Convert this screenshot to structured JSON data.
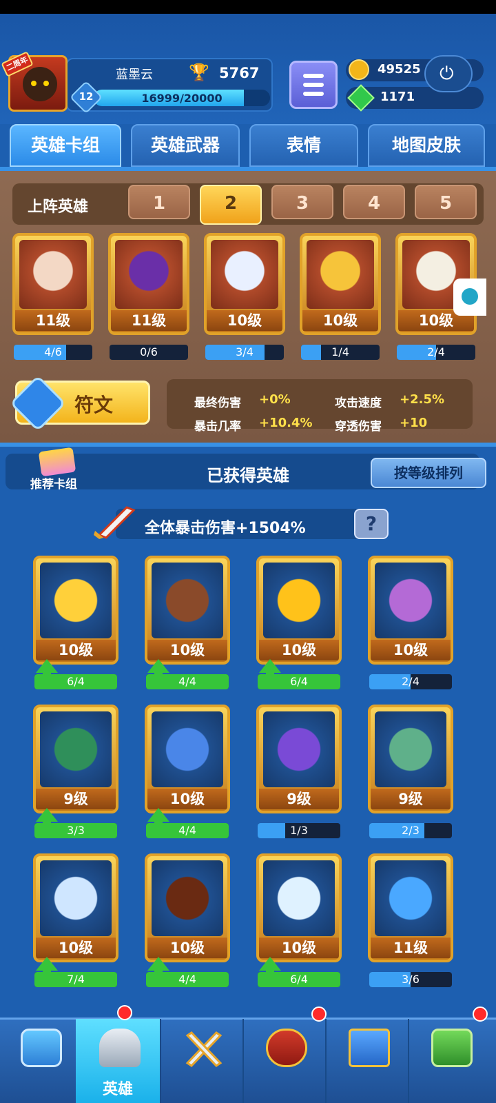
{
  "profile": {
    "anniversary_badge": "二周年",
    "name": "蓝墨云",
    "trophies": "5767",
    "level": "12",
    "xp": "16999/20000",
    "xp_fraction": 0.85
  },
  "currency": {
    "gold": "49525",
    "gems": "1171"
  },
  "tabs": [
    "英雄卡组",
    "英雄武器",
    "表情",
    "地图皮肤"
  ],
  "deck": {
    "label": "上阵英雄",
    "slots": [
      "1",
      "2",
      "3",
      "4",
      "5"
    ],
    "active_slot": "2",
    "cards": [
      {
        "level": "11级",
        "progress": "4/6",
        "fraction": 0.67
      },
      {
        "level": "11级",
        "progress": "0/6",
        "fraction": 0.0
      },
      {
        "level": "10级",
        "progress": "3/4",
        "fraction": 0.75
      },
      {
        "level": "10级",
        "progress": "1/4",
        "fraction": 0.25
      },
      {
        "level": "10级",
        "progress": "2/4",
        "fraction": 0.5
      }
    ]
  },
  "rune": {
    "label": "符文"
  },
  "stats": {
    "final_damage_label": "最终伤害",
    "final_damage_value": "+0%",
    "attack_speed_label": "攻击速度",
    "attack_speed_value": "+2.5%",
    "crit_rate_label": "暴击几率",
    "crit_rate_value": "+10.4%",
    "pierce_label": "穿透伤害",
    "pierce_value": "+10"
  },
  "owned": {
    "recommend_label": "推荐卡组",
    "title": "已获得英雄",
    "sort_label": "按等级排列",
    "crit_bonus": "全体暴击伤害+1504%",
    "help": "?",
    "heroes": [
      {
        "level": "10级",
        "progress": "6/4",
        "fraction": 1.0,
        "upgrade": true
      },
      {
        "level": "10级",
        "progress": "4/4",
        "fraction": 1.0,
        "upgrade": true
      },
      {
        "level": "10级",
        "progress": "6/4",
        "fraction": 1.0,
        "upgrade": true
      },
      {
        "level": "10级",
        "progress": "2/4",
        "fraction": 0.5,
        "upgrade": false
      },
      {
        "level": "9级",
        "progress": "3/3",
        "fraction": 1.0,
        "upgrade": true
      },
      {
        "level": "10级",
        "progress": "4/4",
        "fraction": 1.0,
        "upgrade": true
      },
      {
        "level": "9级",
        "progress": "1/3",
        "fraction": 0.33,
        "upgrade": false
      },
      {
        "level": "9级",
        "progress": "2/3",
        "fraction": 0.67,
        "upgrade": false
      },
      {
        "level": "10级",
        "progress": "7/4",
        "fraction": 1.0,
        "upgrade": true
      },
      {
        "level": "10级",
        "progress": "4/4",
        "fraction": 1.0,
        "upgrade": true
      },
      {
        "level": "10级",
        "progress": "6/4",
        "fraction": 1.0,
        "upgrade": true
      },
      {
        "level": "11级",
        "progress": "3/6",
        "fraction": 0.5,
        "upgrade": false
      }
    ]
  },
  "nav": {
    "items": [
      {
        "icon": "treasure-chest-icon"
      },
      {
        "icon": "helmet-icon",
        "label": "英雄"
      },
      {
        "icon": "crossed-swords-icon"
      },
      {
        "icon": "crown-shield-icon"
      },
      {
        "icon": "team-banner-icon"
      },
      {
        "icon": "sprout-icon"
      }
    ]
  },
  "colors": {
    "background": "#1d5fb0",
    "panel_brown": "#8e6a52",
    "gold_frame": "#e1a229",
    "progress_blue": "#3ba0f4",
    "progress_green": "#36c53a",
    "active_tab": "#5ab6ff"
  }
}
